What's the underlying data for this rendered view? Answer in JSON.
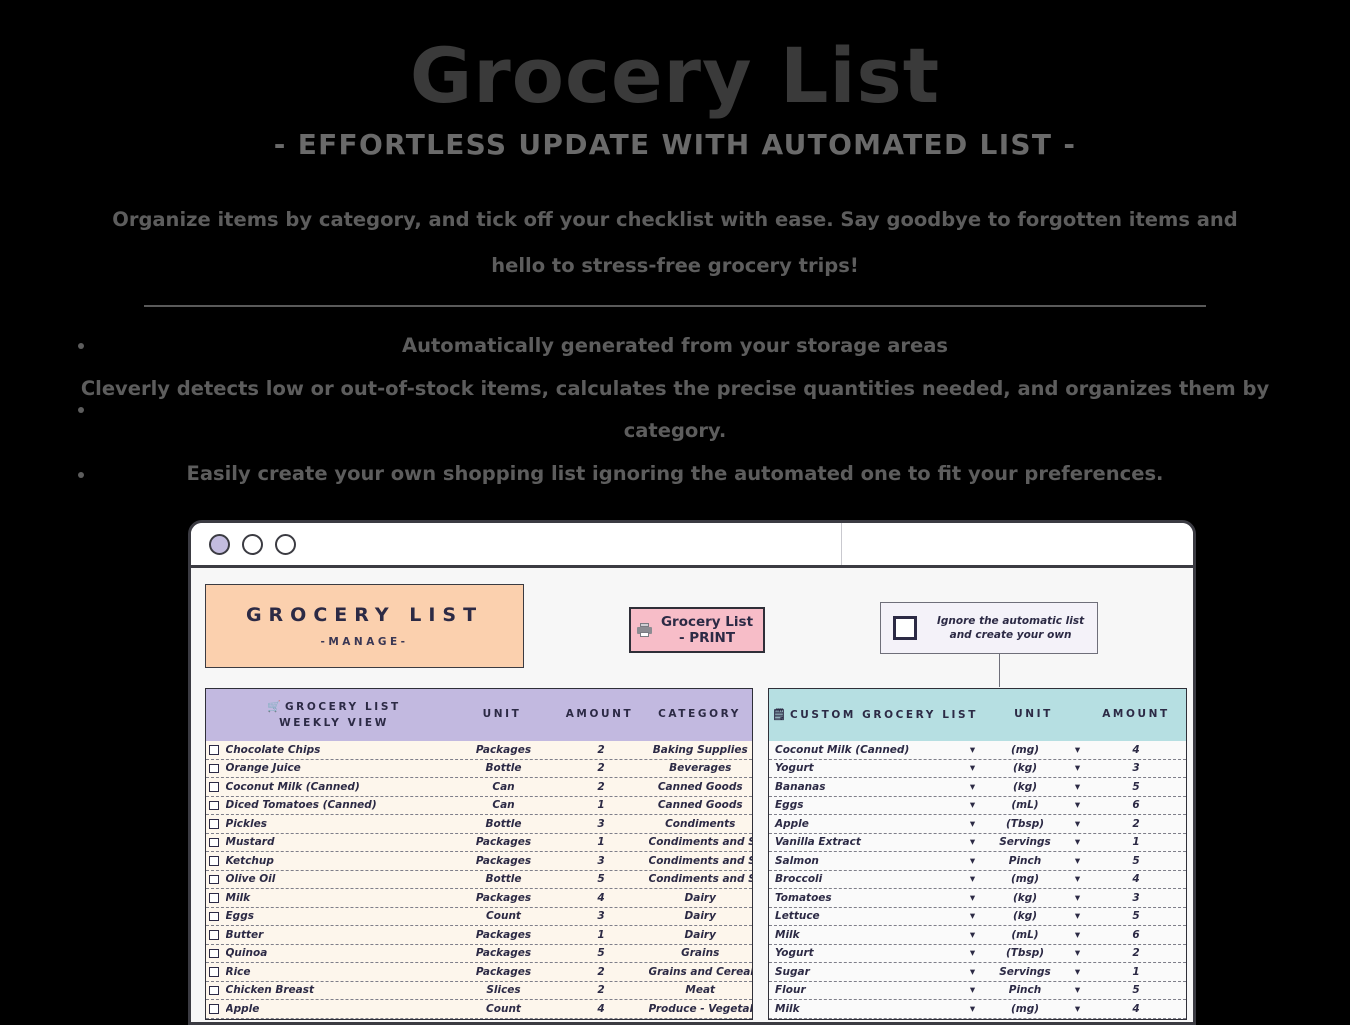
{
  "hero": {
    "title": "Grocery List",
    "subtitle": "- EFFORTLESS UPDATE WITH AUTOMATED LIST -",
    "description": "Organize items by category, and tick off your checklist with ease. Say goodbye to forgotten items and hello to stress-free grocery trips!",
    "bullets": [
      "Automatically generated from your storage areas",
      "Cleverly detects low or out-of-stock items, calculates the precise quantities needed, and organizes them by category.",
      "Easily create your own shopping list ignoring the automated one to fit your preferences."
    ]
  },
  "window": {
    "dots": [
      "window-dot-1",
      "window-dot-2",
      "window-dot-3"
    ]
  },
  "brand": {
    "title": "GROCERY LIST",
    "subtitle": "-MANAGE-"
  },
  "print_button": {
    "label": "Grocery List - PRINT",
    "icon": "printer-icon"
  },
  "ignore_box": {
    "label_line1": "Ignore the automatic list",
    "label_line2": "and create your own",
    "checked": false
  },
  "weekly_table": {
    "icon": "shopping-cart-icon",
    "headers": {
      "name_line1": "GROCERY LIST",
      "name_line2": "WEEKLY VIEW",
      "unit": "UNIT",
      "amount": "AMOUNT",
      "category": "CATEGORY"
    },
    "rows": [
      {
        "name": "Chocolate Chips",
        "unit": "Packages",
        "amount": "2",
        "category": "Baking Supplies"
      },
      {
        "name": "Orange Juice",
        "unit": "Bottle",
        "amount": "2",
        "category": "Beverages"
      },
      {
        "name": "Coconut Milk (Canned)",
        "unit": "Can",
        "amount": "2",
        "category": "Canned Goods"
      },
      {
        "name": "Diced Tomatoes (Canned)",
        "unit": "Can",
        "amount": "1",
        "category": "Canned Goods"
      },
      {
        "name": "Pickles",
        "unit": "Bottle",
        "amount": "3",
        "category": "Condiments"
      },
      {
        "name": "Mustard",
        "unit": "Packages",
        "amount": "1",
        "category": "Condiments and Sauces"
      },
      {
        "name": "Ketchup",
        "unit": "Packages",
        "amount": "3",
        "category": "Condiments and Sauces"
      },
      {
        "name": "Olive Oil",
        "unit": "Bottle",
        "amount": "5",
        "category": "Condiments and Sauces"
      },
      {
        "name": "Milk",
        "unit": "Packages",
        "amount": "4",
        "category": "Dairy"
      },
      {
        "name": "Eggs",
        "unit": "Count",
        "amount": "3",
        "category": "Dairy"
      },
      {
        "name": "Butter",
        "unit": "Packages",
        "amount": "1",
        "category": "Dairy"
      },
      {
        "name": "Quinoa",
        "unit": "Packages",
        "amount": "5",
        "category": "Grains"
      },
      {
        "name": "Rice",
        "unit": "Packages",
        "amount": "2",
        "category": "Grains and Cereals"
      },
      {
        "name": "Chicken Breast",
        "unit": "Slices",
        "amount": "2",
        "category": "Meat"
      },
      {
        "name": "Apple",
        "unit": "Count",
        "amount": "4",
        "category": "Produce - Vegetables"
      }
    ]
  },
  "custom_table": {
    "icon": "note-icon",
    "headers": {
      "name": "CUSTOM GROCERY LIST",
      "unit": "UNIT",
      "amount": "AMOUNT"
    },
    "rows": [
      {
        "name": "Coconut Milk (Canned)",
        "unit": "(mg)",
        "amount": "4"
      },
      {
        "name": "Yogurt",
        "unit": "(kg)",
        "amount": "3"
      },
      {
        "name": "Bananas",
        "unit": "(kg)",
        "amount": "5"
      },
      {
        "name": "Eggs",
        "unit": "(mL)",
        "amount": "6"
      },
      {
        "name": "Apple",
        "unit": "(Tbsp)",
        "amount": "2"
      },
      {
        "name": "Vanilla Extract",
        "unit": "Servings",
        "amount": "1"
      },
      {
        "name": "Salmon",
        "unit": "Pinch",
        "amount": "5"
      },
      {
        "name": "Broccoli",
        "unit": "(mg)",
        "amount": "4"
      },
      {
        "name": "Tomatoes",
        "unit": "(kg)",
        "amount": "3"
      },
      {
        "name": "Lettuce",
        "unit": "(kg)",
        "amount": "5"
      },
      {
        "name": "Milk",
        "unit": "(mL)",
        "amount": "6"
      },
      {
        "name": "Yogurt",
        "unit": "(Tbsp)",
        "amount": "2"
      },
      {
        "name": "Sugar",
        "unit": "Servings",
        "amount": "1"
      },
      {
        "name": "Flour",
        "unit": "Pinch",
        "amount": "5"
      },
      {
        "name": "Milk",
        "unit": "(mg)",
        "amount": "4"
      }
    ]
  },
  "colors": {
    "background": "#000000",
    "brand_bg": "#fbd0ae",
    "print_bg": "#f7bdc8",
    "weekly_header": "#c2b9e0",
    "custom_header": "#b6dfe2",
    "row_bg_left": "#fdf6ec",
    "selection": "#2f6fe0",
    "ink": "#2c2a45"
  }
}
